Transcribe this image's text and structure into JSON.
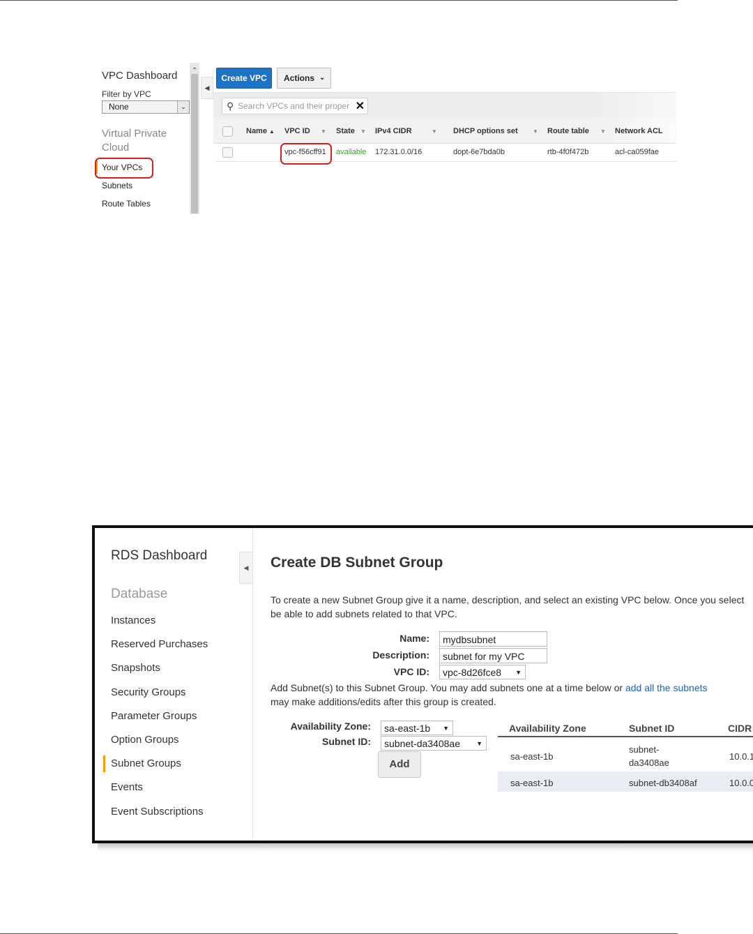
{
  "vpc": {
    "dashboard_title": "VPC Dashboard",
    "filter_label": "Filter by VPC",
    "filter_value": "None",
    "section": "Virtual Private Cloud",
    "nav": [
      "Your VPCs",
      "Subnets",
      "Route Tables"
    ],
    "create_button": "Create VPC",
    "actions_button": "Actions",
    "search_placeholder": "Search VPCs and their proper",
    "columns": [
      "Name",
      "VPC ID",
      "State",
      "IPv4 CIDR",
      "DHCP options set",
      "Route table",
      "Network ACL"
    ],
    "row": {
      "name": "",
      "vpc_id": "vpc-f56cff91",
      "state": "available",
      "cidr": "172.31.0.0/16",
      "dhcp": "dopt-6e7bda0b",
      "route_table": "rtb-4f0f472b",
      "acl": "acl-ca059fae"
    },
    "colors": {
      "primary_button": "#1f73c4",
      "state_available": "#3a9a2a",
      "highlight": "#d42020",
      "active_nav": "#ff9900"
    }
  },
  "rds": {
    "dashboard_title": "RDS Dashboard",
    "section": "Database",
    "nav": [
      "Instances",
      "Reserved Purchases",
      "Snapshots",
      "Security Groups",
      "Parameter Groups",
      "Option Groups",
      "Subnet Groups",
      "Events",
      "Event Subscriptions"
    ],
    "page_title": "Create DB Subnet Group",
    "intro_line1": "To create a new Subnet Group give it a name, description, and select an existing VPC below. Once you select",
    "intro_line2": "be able to add subnets related to that VPC.",
    "name_label": "Name:",
    "name_value": "mydbsubnet",
    "description_label": "Description:",
    "description_value": "subnet for my VPC",
    "vpc_label": "VPC ID:",
    "vpc_value": "vpc-8d26fce8",
    "add_line1": "Add Subnet(s) to this Subnet Group. You may add subnets one at a time below or",
    "add_link": "add all the subnets",
    "add_line2": "may make additions/edits after this group is created.",
    "az_label": "Availability Zone:",
    "az_value": "sa-east-1b",
    "subnet_label": "Subnet ID:",
    "subnet_value": "subnet-da3408ae",
    "add_button": "Add",
    "table_headers": [
      "Availability Zone",
      "Subnet ID",
      "CIDR B"
    ],
    "table_rows": [
      {
        "az": "sa-east-1b",
        "subnet_line1": "subnet-",
        "subnet_line2": "da3408ae",
        "cidr": "10.0.1"
      },
      {
        "az": "sa-east-1b",
        "subnet": "subnet-db3408af",
        "cidr": "10.0.0"
      }
    ],
    "colors": {
      "link": "#1a66b5",
      "active_nav": "#ff9900",
      "selected_row": "#e9edf3"
    }
  }
}
